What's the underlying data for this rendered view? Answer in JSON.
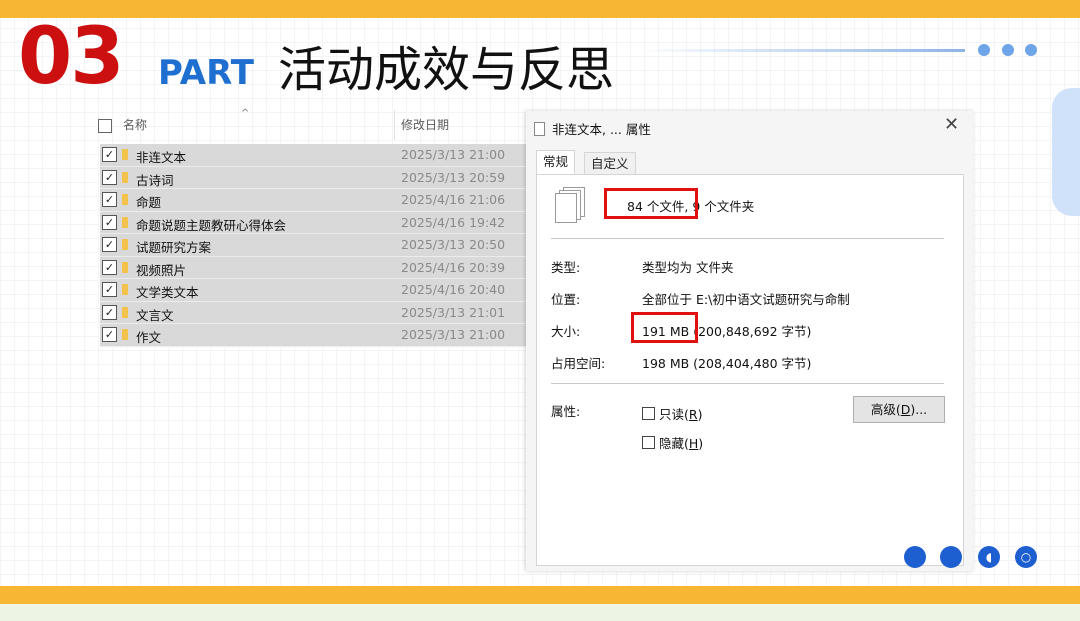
{
  "slide": {
    "section_number": "03",
    "part_label": "PART",
    "heading": "活动成效与反思"
  },
  "explorer": {
    "columns": {
      "name": "名称",
      "date": "修改日期"
    },
    "rows": [
      {
        "name": "非连文本",
        "date": "2025/3/13 21:00"
      },
      {
        "name": "古诗词",
        "date": "2025/3/13 20:59"
      },
      {
        "name": "命题",
        "date": "2025/4/16 21:06"
      },
      {
        "name": "命题说题主题教研心得体会",
        "date": "2025/4/16 19:42"
      },
      {
        "name": "试题研究方案",
        "date": "2025/3/13 20:50"
      },
      {
        "name": "视频照片",
        "date": "2025/4/16 20:39"
      },
      {
        "name": "文学类文本",
        "date": "2025/4/16 20:40"
      },
      {
        "name": "文言文",
        "date": "2025/3/13 21:01"
      },
      {
        "name": "作文",
        "date": "2025/3/13 21:00"
      }
    ]
  },
  "dialog": {
    "title": "非连文本, ... 属性",
    "tabs": [
      "常规",
      "自定义"
    ],
    "file_count": "84 个文件,",
    "folder_count": "9 个文件夹",
    "type_label": "类型:",
    "type_value": "类型均为 文件夹",
    "location_label": "位置:",
    "location_value": "全部位于 E:\\初中语文试题研究与命制",
    "size_label": "大小:",
    "size_value_mb": "191 MB",
    "size_value_bytes": "(200,848,692 字节)",
    "disk_label": "占用空间:",
    "disk_value": "198 MB (208,404,480 字节)",
    "attr_label": "属性:",
    "readonly_label": "只读(",
    "readonly_key": "R",
    "hidden_label": "隐藏(",
    "hidden_key": "H",
    "advanced_label": "高级(",
    "advanced_key": "D",
    "advanced_suffix": ")...",
    "close_paren": ")"
  },
  "colors": {
    "band": "#f7b733",
    "number_red": "#cc1010",
    "part_blue": "#1f6fd0",
    "highlight_red": "#e01010"
  }
}
